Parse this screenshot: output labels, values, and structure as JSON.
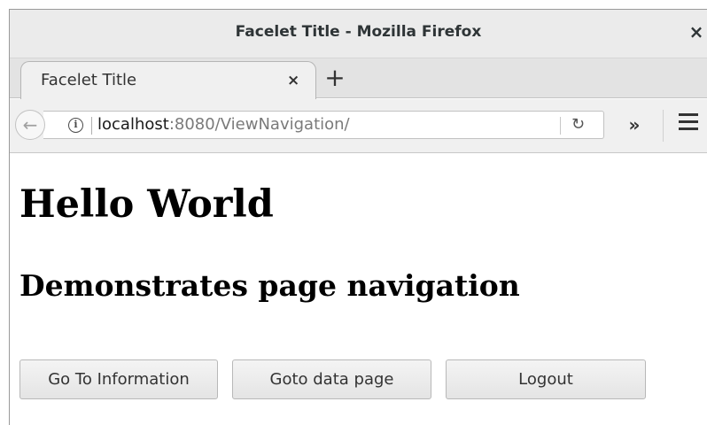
{
  "window": {
    "title": "Facelet Title - Mozilla Firefox",
    "close_glyph": "×"
  },
  "tabs": [
    {
      "label": "Facelet Title",
      "close_glyph": "×"
    }
  ],
  "new_tab_glyph": "+",
  "navbar": {
    "back_glyph": "←",
    "info_glyph": "i",
    "url_host": "localhost",
    "url_rest": ":8080/ViewNavigation/",
    "reload_glyph": "↻",
    "overflow_glyph": "»"
  },
  "page": {
    "heading": "Hello World",
    "subheading": "Demonstrates page navigation",
    "buttons": [
      {
        "label": "Go To Information"
      },
      {
        "label": "Goto data page"
      },
      {
        "label": "Logout"
      }
    ]
  }
}
